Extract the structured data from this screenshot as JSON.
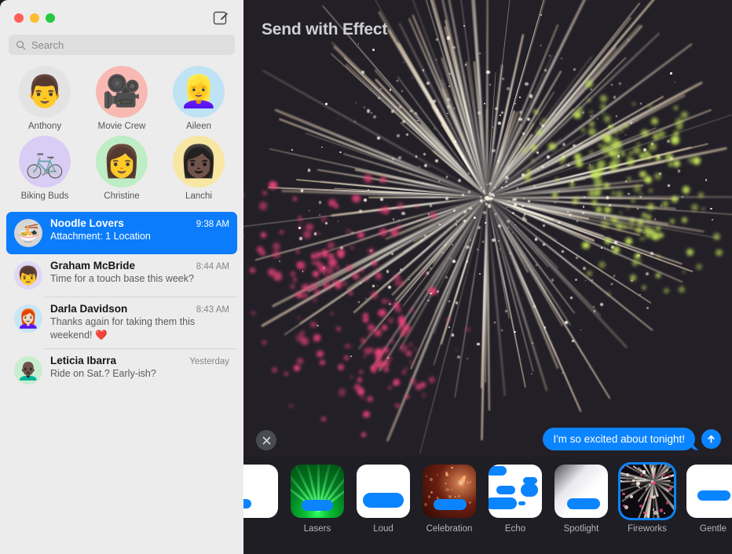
{
  "window": {
    "traffic_lights": [
      "close",
      "minimize",
      "zoom"
    ],
    "compose_icon": "compose-pencil-icon"
  },
  "search": {
    "placeholder": "Search",
    "value": "",
    "icon": "search-icon"
  },
  "pinned": [
    {
      "name": "Anthony",
      "glyph": "👨",
      "bg": "#e3e3e3"
    },
    {
      "name": "Movie Crew",
      "glyph": "🎥",
      "bg": "#f8b9b3"
    },
    {
      "name": "Aileen",
      "glyph": "👱‍♀️",
      "bg": "#bfe3f5"
    },
    {
      "name": "Biking Buds",
      "glyph": "🚲",
      "bg": "#d9cdf5"
    },
    {
      "name": "Christine",
      "glyph": "👩",
      "bg": "#bfedc6"
    },
    {
      "name": "Lanchi",
      "glyph": "👩🏿",
      "bg": "#f8e6a3"
    }
  ],
  "conversations": [
    {
      "name": "Noodle Lovers",
      "time": "9:38 AM",
      "preview": "Attachment: 1 Location",
      "glyph": "🍜",
      "bg": "#d6d6d6",
      "selected": true
    },
    {
      "name": "Graham McBride",
      "time": "8:44 AM",
      "preview": "Time for a touch base this week?",
      "glyph": "👦",
      "bg": "#e0d7f7",
      "selected": false
    },
    {
      "name": "Darla Davidson",
      "time": "8:43 AM",
      "preview": "Thanks again for taking them this weekend! ❤️",
      "glyph": "👩🏻‍🦰",
      "bg": "#c7e6f6",
      "selected": false
    },
    {
      "name": "Leticia Ibarra",
      "time": "Yesterday",
      "preview": "Ride on Sat.? Early-ish?",
      "glyph": "👨🏿‍🦲",
      "bg": "#c8eed0",
      "selected": false
    }
  ],
  "stage": {
    "title": "Send with Effect",
    "background": "#221f27",
    "effect_preview": "fireworks"
  },
  "compose": {
    "close_icon": "close-icon",
    "message": "I'm so excited about tonight!",
    "send_icon": "send-arrow-up-icon",
    "bubble_color": "#0b84ff"
  },
  "effects": {
    "selected": "Fireworks",
    "items": [
      {
        "label": "",
        "kind": "partial",
        "selected": false
      },
      {
        "label": "Lasers",
        "kind": "lasers",
        "selected": false
      },
      {
        "label": "Loud",
        "kind": "loud",
        "selected": false
      },
      {
        "label": "Celebration",
        "kind": "celebration",
        "selected": false
      },
      {
        "label": "Echo",
        "kind": "echo",
        "selected": false
      },
      {
        "label": "Spotlight",
        "kind": "spotlight",
        "selected": false
      },
      {
        "label": "Fireworks",
        "kind": "fireworks",
        "selected": true
      },
      {
        "label": "Gentle",
        "kind": "gentle",
        "selected": false
      }
    ]
  },
  "colors": {
    "accent_blue": "#0b7cfb",
    "sidebar_bg": "#ececec",
    "panel_bg": "#221f27",
    "strip_bg": "#201e25",
    "firework_white": "#fff6e8",
    "firework_pink": "#f0457c",
    "firework_green": "#c8e85c"
  }
}
